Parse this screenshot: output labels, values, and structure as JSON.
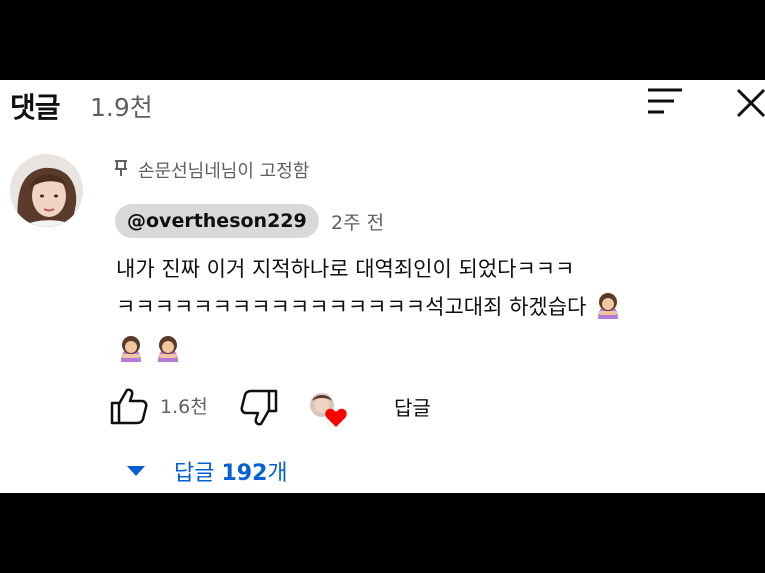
{
  "header": {
    "title": "댓글",
    "count": "1.9천"
  },
  "comment": {
    "pinned_text": "손문선님네님이 고정함",
    "author": "@overtheson229",
    "time": "2주 전",
    "text_line1": "내가 진짜 이거 지적하나로 대역죄인이 되었다ㅋㅋㅋ",
    "text_line2": "ㅋㅋㅋㅋㅋㅋㅋㅋㅋㅋㅋㅋㅋㅋㅋㅋ석고대죄 하겠습다",
    "emoji_names": [
      "person-bowing-emoji",
      "person-bowing-emoji",
      "person-bowing-emoji"
    ]
  },
  "actions": {
    "like_count": "1.6천",
    "reply_label": "답글"
  },
  "replies": {
    "prefix": "답글",
    "count": "192",
    "suffix": "개"
  },
  "colors": {
    "link_blue": "#065fd4",
    "heart_red": "#ff0000",
    "handle_bg": "#d9d9d9",
    "secondary_text": "#606060"
  }
}
